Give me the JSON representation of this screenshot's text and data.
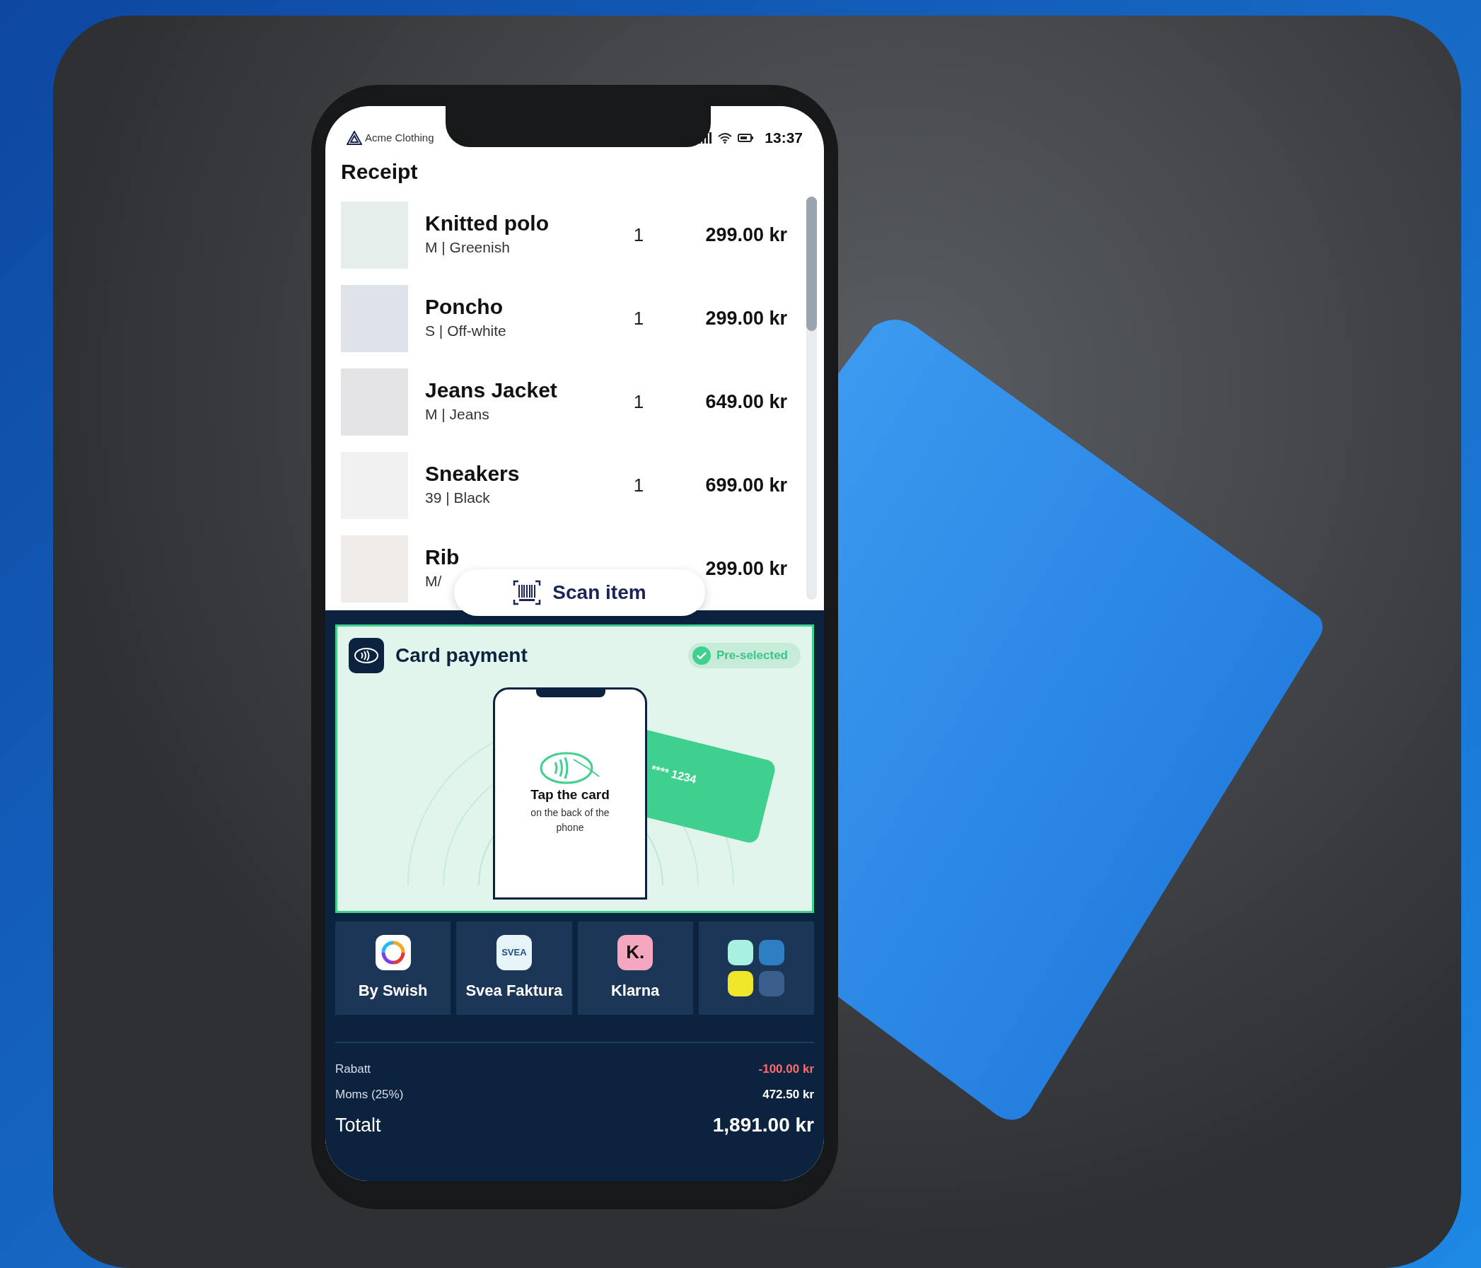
{
  "status_bar": {
    "app_name": "Acme Clothing",
    "time": "13:37"
  },
  "title": "Receipt",
  "items": [
    {
      "name": "Knitted polo",
      "variant": "M | Greenish",
      "qty": "1",
      "price": "299.00 kr",
      "kind": "sweater"
    },
    {
      "name": "Poncho",
      "variant": "S | Off-white",
      "qty": "1",
      "price": "299.00 kr",
      "kind": "poncho"
    },
    {
      "name": "Jeans Jacket",
      "variant": "M | Jeans",
      "qty": "1",
      "price": "649.00 kr",
      "kind": "jacket"
    },
    {
      "name": "Sneakers",
      "variant": "39 | Black",
      "qty": "1",
      "price": "699.00 kr",
      "kind": "shoe"
    },
    {
      "name": "Rib",
      "variant": "M/",
      "price": "299.00 kr",
      "kind": "pants"
    }
  ],
  "scan_button": {
    "label": "Scan item"
  },
  "payment": {
    "title": "Card payment",
    "badge": "Pre-selected",
    "selected": true,
    "instruction": "Tap the card",
    "instruction_detail": "on the back of the phone",
    "card_number": "**** 1234"
  },
  "methods": [
    {
      "label": "By Swish",
      "kind": "swish"
    },
    {
      "label": "Svea Faktura",
      "kind": "svea",
      "logo_text": "SVEA"
    },
    {
      "label": "Klarna",
      "kind": "klarna",
      "logo_text": "K."
    },
    {
      "kind": "more"
    }
  ],
  "summary": [
    {
      "label": "Rabatt",
      "value": "-100.00 kr",
      "kind": "discount"
    },
    {
      "label": "Moms (25%)",
      "value": "472.50 kr",
      "kind": "line"
    },
    {
      "label": "Totalt",
      "value": "1,891.00 kr",
      "kind": "total"
    }
  ]
}
